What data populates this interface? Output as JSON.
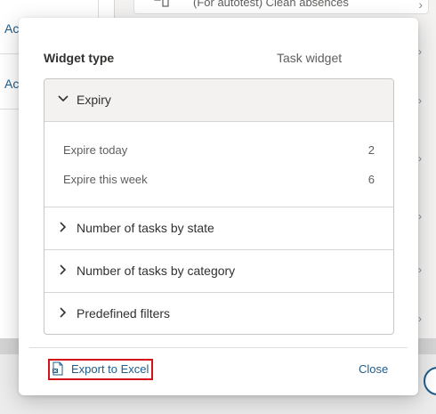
{
  "background": {
    "left_rows": [
      "Ac",
      "Ac"
    ],
    "top_item_text": "(For autotest) Clean absences"
  },
  "dialog": {
    "widget_type_label": "Widget type",
    "widget_type_value": "Task widget",
    "sections": [
      {
        "title": "Expiry",
        "expanded": true,
        "items": [
          {
            "label": "Expire today",
            "value": "2"
          },
          {
            "label": "Expire this week",
            "value": "6"
          }
        ]
      },
      {
        "title": "Number of tasks by state",
        "expanded": false
      },
      {
        "title": "Number of tasks by category",
        "expanded": false
      },
      {
        "title": "Predefined filters",
        "expanded": false
      }
    ],
    "footer": {
      "export_label": "Export to Excel",
      "close_label": "Close"
    }
  },
  "colors": {
    "link": "#1f5c8a",
    "highlight_border": "#d4121a"
  },
  "icons": {
    "chevron_down": "chevron-down-icon",
    "chevron_right": "chevron-right-icon",
    "excel": "excel-file-icon"
  }
}
